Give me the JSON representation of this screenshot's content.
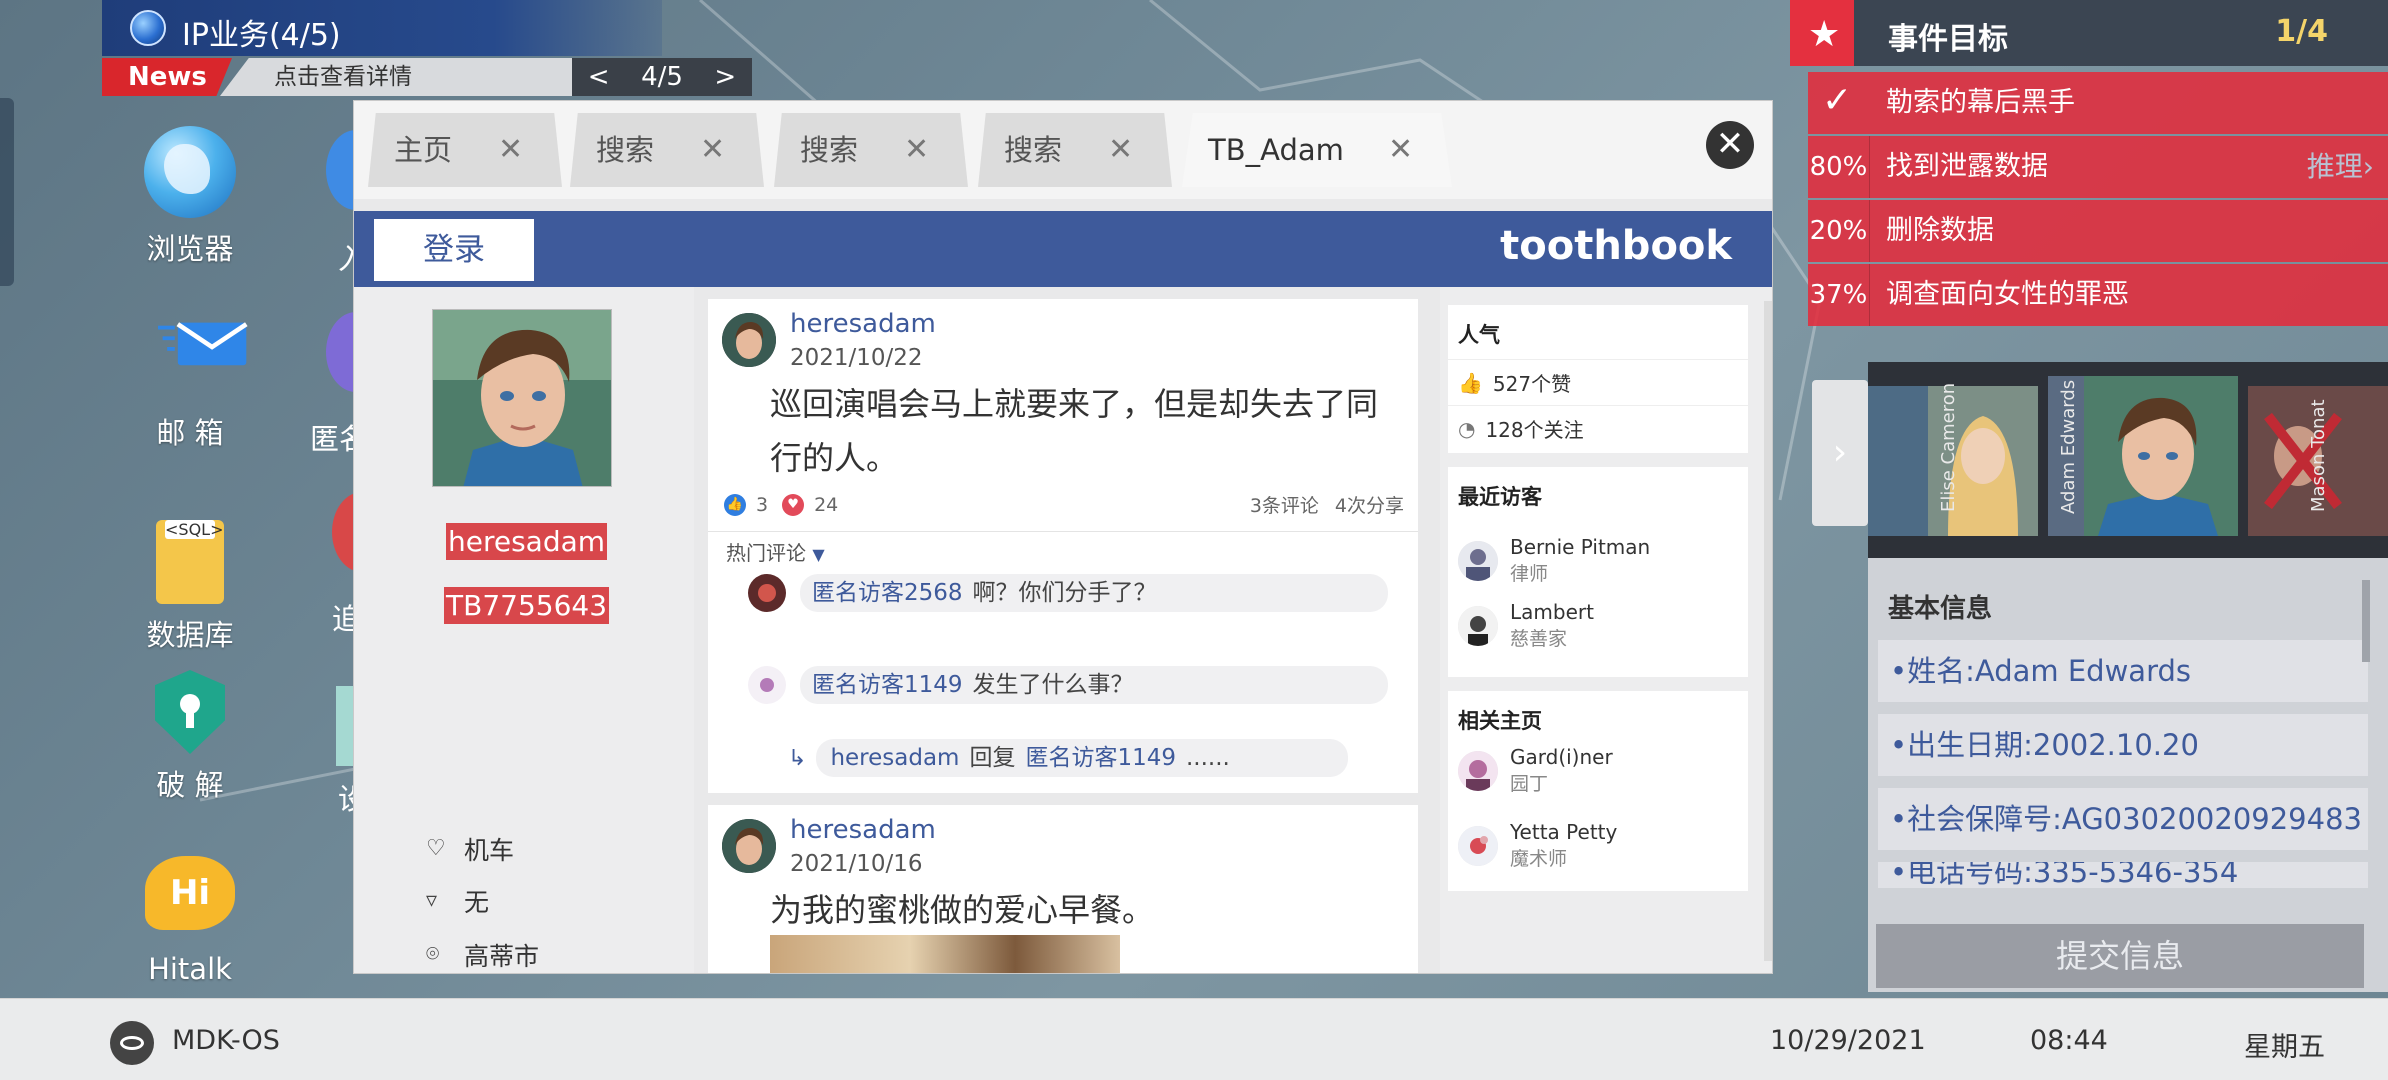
{
  "ip_task": {
    "title": "IP业务(4/5)",
    "news_tag": "News",
    "news_text": "点击查看详情",
    "page": "4/5",
    "prev": "<",
    "next": ">"
  },
  "desktop": [
    {
      "label": "浏览器",
      "icon": "browser-icon"
    },
    {
      "label": "邮 箱",
      "icon": "mail-icon"
    },
    {
      "label": "数据库",
      "icon": "database-icon",
      "badge": "<SQL>"
    },
    {
      "label": "破 解",
      "icon": "crack-icon"
    },
    {
      "label": "Hitalk",
      "icon": "hitalk-icon",
      "badge": "Hi"
    }
  ],
  "desktop_partial": [
    "入",
    "匿名",
    "追",
    "设"
  ],
  "browser": {
    "tabs": [
      {
        "label": "主页",
        "active": false
      },
      {
        "label": "搜索",
        "active": false
      },
      {
        "label": "搜索",
        "active": false
      },
      {
        "label": "搜索",
        "active": false
      },
      {
        "label": "TB_Adam",
        "active": true
      }
    ],
    "tab_close": "✕",
    "close": "✕",
    "login": "登录",
    "brand": "toothbook"
  },
  "profile": {
    "username": "heresadam",
    "id": "TB7755643",
    "attributes": [
      {
        "icon": "heart-icon",
        "text": "机车"
      },
      {
        "icon": "tie-icon",
        "text": "无"
      },
      {
        "icon": "location-icon",
        "text": "高蒂市"
      }
    ]
  },
  "posts": [
    {
      "user": "heresadam",
      "date": "2021/10/22",
      "text": "巡回演唱会马上就要来了，但是却失去了同行的人。",
      "likes": "3",
      "loves": "24",
      "comments": "3条评论",
      "shares": "4次分享",
      "hot_label": "热门评论",
      "comment_list": [
        {
          "name": "匿名访客2568",
          "text": "啊？你们分手了？"
        },
        {
          "name": "匿名访客1149",
          "text": "发生了什么事？"
        }
      ],
      "reply": {
        "name": "heresadam",
        "action": "回复",
        "target": "匿名访客1149",
        "text": "......"
      }
    },
    {
      "user": "heresadam",
      "date": "2021/10/16",
      "text": "为我的蜜桃做的爱心早餐。"
    }
  ],
  "side": {
    "popularity_title": "人气",
    "likes": "527个赞",
    "follows": "128个关注",
    "visitors_title": "最近访客",
    "visitors": [
      {
        "name": "Bernie Pitman",
        "role": "律师"
      },
      {
        "name": "Lambert",
        "role": "慈善家"
      }
    ],
    "related_title": "相关主页",
    "related": [
      {
        "name": "Gard(i)ner",
        "role": "园丁"
      },
      {
        "name": "Yetta Petty",
        "role": "魔术师"
      }
    ]
  },
  "objectives": {
    "title": "事件目标",
    "count": "1/4",
    "items": [
      {
        "pct": "",
        "text": "勒索的幕后黑手",
        "done": true
      },
      {
        "pct": "80%",
        "text": "找到泄露数据",
        "hint": "推理›"
      },
      {
        "pct": "20%",
        "text": "删除数据"
      },
      {
        "pct": "37%",
        "text": "调查面向女性的罪恶"
      }
    ]
  },
  "character": {
    "expand": "›",
    "names": [
      "Elise Cameron",
      "Adam Edwards",
      "Mason Tonat"
    ],
    "basic_title": "基本信息",
    "info": [
      "•姓名:Adam Edwards",
      "•出生日期:2002.10.20",
      "•社会保障号:AG03020020929483",
      "•电话号码:335-5346-354"
    ],
    "submit": "提交信息"
  },
  "taskbar": {
    "os": "MDK-OS",
    "date": "10/29/2021",
    "time": "08:44",
    "day": "星期五"
  }
}
